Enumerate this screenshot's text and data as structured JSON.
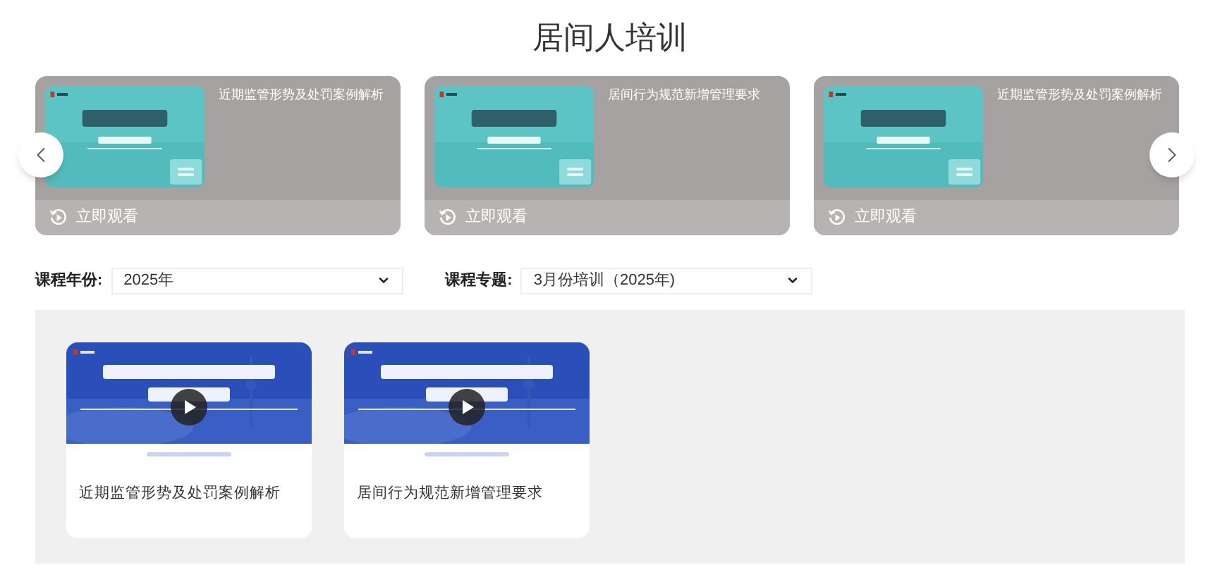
{
  "page_title": "居间人培训",
  "carousel": {
    "items": [
      {
        "title": "近期监管形势及处罚案例解析",
        "action": "立即观看"
      },
      {
        "title": "居间行为规范新增管理要求",
        "action": "立即观看"
      },
      {
        "title": "近期监管形势及处罚案例解析",
        "action": "立即观看"
      }
    ]
  },
  "filters": [
    {
      "label": "课程年份:",
      "value": "2025年"
    },
    {
      "label": "课程专题:",
      "value": "3月份培训（2025年)"
    }
  ],
  "videos": [
    {
      "title": "近期监管形势及处罚案例解析"
    },
    {
      "title": "居间行为规范新增管理要求"
    }
  ]
}
